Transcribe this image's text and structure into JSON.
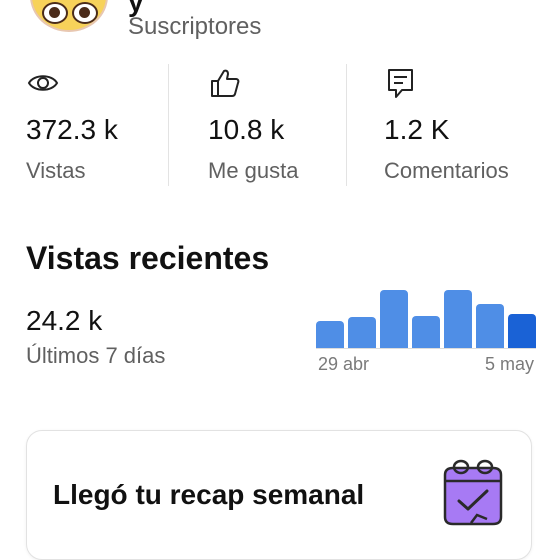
{
  "header": {
    "channel_name_partial": "y",
    "subscribers_label": "Suscriptores"
  },
  "stats": [
    {
      "icon": "eye-icon",
      "value": "372.3 k",
      "label": "Vistas"
    },
    {
      "icon": "thumbs-up-icon",
      "value": "10.8 k",
      "label": "Me gusta"
    },
    {
      "icon": "comment-icon",
      "value": "1.2 K",
      "label": "Comentarios"
    }
  ],
  "recent": {
    "title": "Vistas recientes",
    "value": "24.2 k",
    "period_label": "Últimos 7 días",
    "date_start": "29 abr",
    "date_end": "5 may"
  },
  "chart_data": {
    "type": "bar",
    "title": "",
    "categories": [
      "29 abr",
      "",
      "",
      "",
      "",
      "",
      "5 may"
    ],
    "values": [
      0.46,
      0.53,
      1.0,
      0.55,
      1.0,
      0.76,
      0.58
    ],
    "ylim": [
      0,
      1
    ],
    "grid": false,
    "colors": {
      "bar": "#4f8ee6",
      "highlight": "#1a62d6"
    },
    "highlight_index": 6
  },
  "recap": {
    "text": "Llegó tu recap semanal",
    "icon": "calendar-check-icon",
    "icon_color": "#9b67f0"
  }
}
